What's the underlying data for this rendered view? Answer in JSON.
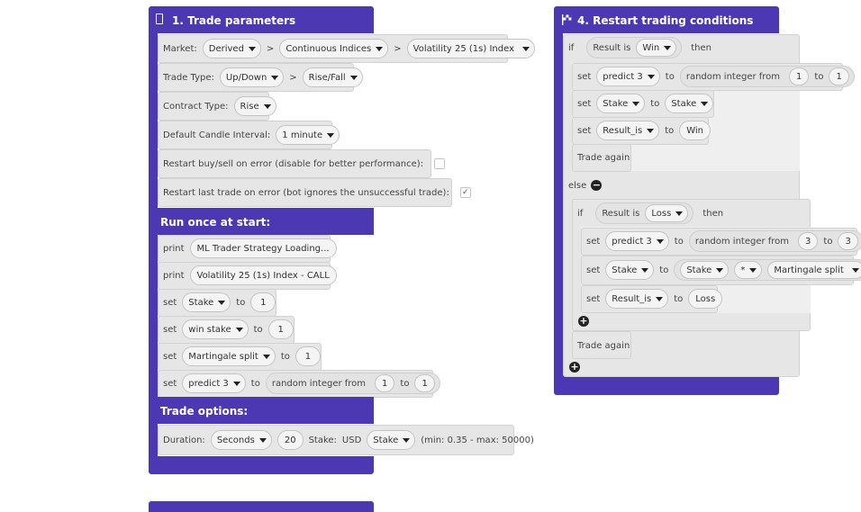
{
  "trade_params": {
    "title": "1. Trade parameters",
    "market_label": "Market:",
    "market": "Derived",
    "submarket": "Continuous Indices",
    "symbol": "Volatility 25 (1s) Index",
    "sep": ">",
    "trade_type_label": "Trade Type:",
    "trade_type_category": "Up/Down",
    "trade_type": "Rise/Fall",
    "contract_type_label": "Contract Type:",
    "contract_type": "Rise",
    "candle_label": "Default Candle Interval:",
    "candle_interval": "1 minute",
    "restart_buysell_label": "Restart buy/sell on error (disable for better performance):",
    "restart_buysell_checked": false,
    "restart_last_label": "Restart last trade on error (bot ignores the unsuccessful trade):",
    "restart_last_checked": true,
    "restart_last_mark": "✓"
  },
  "run_once": {
    "title": "Run once at start:",
    "print_kw": "print",
    "print1": "ML Trader Strategy Loading...",
    "print2": "Volatility 25 (1s) Index - CALL",
    "set_kw": "set",
    "to_kw": "to",
    "var1": "Stake",
    "val1": "1",
    "var2": "win stake",
    "val2": "1",
    "var3": "Martingale split",
    "val3": "1",
    "var4": "predict 3",
    "rand_label": "random integer from",
    "rand_from": "1",
    "rand_to": "1"
  },
  "trade_options": {
    "title": "Trade options:",
    "duration_label": "Duration:",
    "duration_unit": "Seconds",
    "duration_value": "20",
    "stake_label": "Stake:",
    "currency": "USD",
    "stake_var": "Stake",
    "limits": "(min: 0.35 - max: 50000)"
  },
  "restart": {
    "title": "4. Restart trading conditions",
    "if_kw": "if",
    "then_kw": "then",
    "else_kw": "else",
    "result_is": "Result is",
    "win": "Win",
    "loss": "Loss",
    "set_kw": "set",
    "to_kw": "to",
    "predict": "predict 3",
    "rand_label": "random integer from",
    "win_from": "1",
    "win_to": "1",
    "stake": "Stake",
    "result_var": "Result_is",
    "trade_again": "Trade again",
    "loss_from": "3",
    "loss_to": "3",
    "multiply": "*",
    "martingale": "Martingale split",
    "minus": "−",
    "plus": "+"
  }
}
